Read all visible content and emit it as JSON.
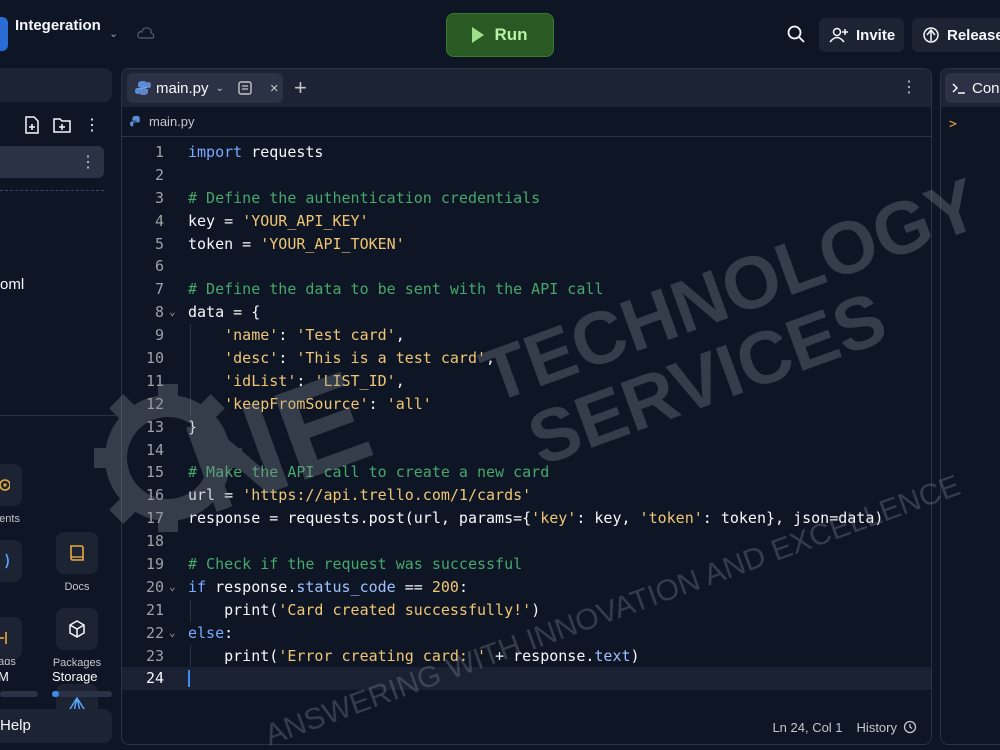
{
  "header": {
    "app_name": "Integeration",
    "run_label": "Run",
    "invite_label": "Invite",
    "release_label": "Release"
  },
  "sidebar": {
    "file_partial": "oml",
    "tools": [
      {
        "label": "ments",
        "icon": "secrets-icon"
      },
      {
        "label": "Docs",
        "icon": "docs-icon"
      },
      {
        "label": "ads",
        "icon": "threads-icon"
      },
      {
        "label": "Packages",
        "icon": "packages-icon"
      },
      {
        "label": "",
        "icon": "ram-icon"
      },
      {
        "label": "",
        "icon": "storage-icon"
      }
    ],
    "meters": {
      "ram_label": "M",
      "storage_label": "Storage",
      "ram_fraction": 0.0,
      "storage_fraction": 0.12
    },
    "help_label": "Help"
  },
  "editor": {
    "tab_name": "main.py",
    "breadcrumb": "main.py",
    "lines": [
      "import requests",
      "",
      "# Define the authentication credentials",
      "key = 'YOUR_API_KEY'",
      "token = 'YOUR_API_TOKEN'",
      "",
      "# Define the data to be sent with the API call",
      "data = {",
      "    'name': 'Test card',",
      "    'desc': 'This is a test card',",
      "    'idList': 'LIST_ID',",
      "    'keepFromSource': 'all'",
      "}",
      "",
      "# Make the API call to create a new card",
      "url = 'https://api.trello.com/1/cards'",
      "response = requests.post(url, params={'key': key, 'token': token}, json=data)",
      "",
      "# Check if the request was successful",
      "if response.status_code == 200:",
      "    print('Card created successfully!')",
      "else:",
      "    print('Error creating card: ' + response.text)",
      ""
    ],
    "fold_lines": [
      8,
      20,
      22
    ],
    "active_line": 24,
    "status_position": "Ln 24, Col 1",
    "history_label": "History"
  },
  "console": {
    "tab_label": "Cons",
    "prompt": ">"
  },
  "watermark": {
    "line1": "TECHNOLOGY",
    "line2": "SERVICES",
    "tagline": "ANSWERING WITH INNOVATION AND EXCELLENCE",
    "logo_letters": "NE"
  },
  "colors": {
    "background": "#0e1525",
    "panel": "#1c2333",
    "run_green": "#2a5a24",
    "keyword": "#7aa9ff",
    "comment": "#46a86a",
    "string": "#f0c674"
  }
}
